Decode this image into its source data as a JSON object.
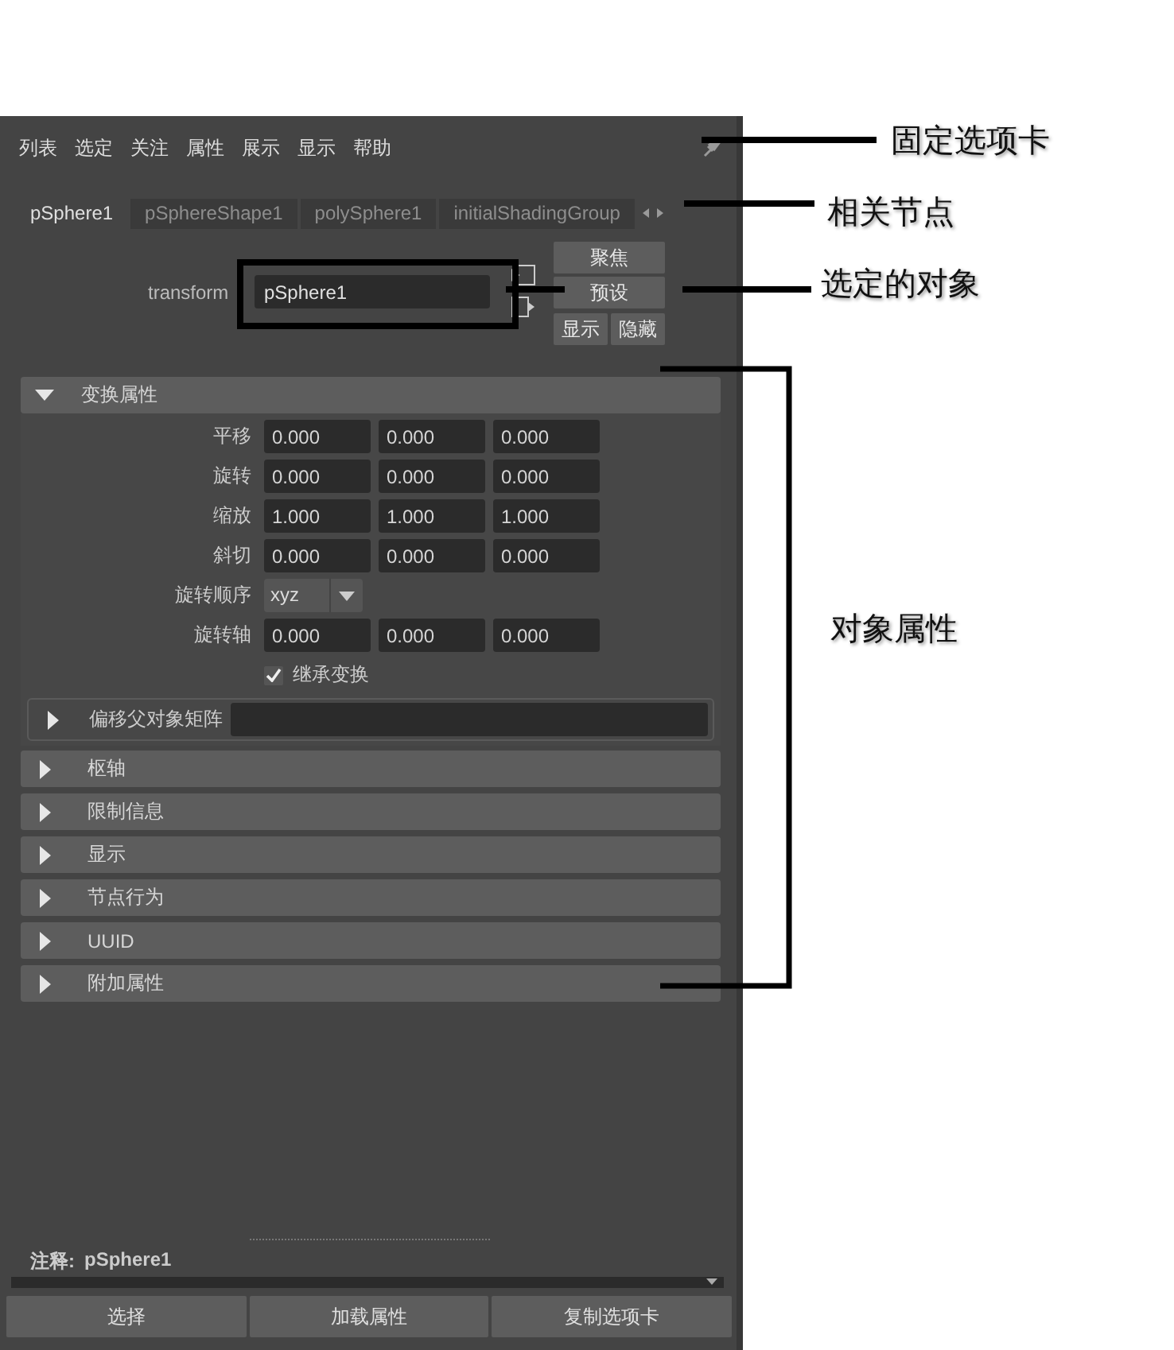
{
  "menu": [
    "列表",
    "选定",
    "关注",
    "属性",
    "展示",
    "显示",
    "帮助"
  ],
  "tabs": [
    {
      "label": "pSphere1",
      "selected": true
    },
    {
      "label": "pSphereShape1",
      "selected": false
    },
    {
      "label": "polySphere1",
      "selected": false
    },
    {
      "label": "initialShadingGroup",
      "selected": false
    }
  ],
  "node": {
    "label": "transform",
    "value": "pSphere1"
  },
  "node_buttons": [
    "聚焦",
    "预设"
  ],
  "show_hide": [
    "显示",
    "隐藏"
  ],
  "sections": [
    {
      "title": "变换属性",
      "expanded": true,
      "rows": [
        {
          "kind": "vector",
          "label": "平移",
          "values": [
            "0.000",
            "0.000",
            "0.000"
          ]
        },
        {
          "kind": "vector",
          "label": "旋转",
          "values": [
            "0.000",
            "0.000",
            "0.000"
          ]
        },
        {
          "kind": "vector",
          "label": "缩放",
          "values": [
            "1.000",
            "1.000",
            "1.000"
          ]
        },
        {
          "kind": "vector",
          "label": "斜切",
          "values": [
            "0.000",
            "0.000",
            "0.000"
          ]
        },
        {
          "kind": "dropdown",
          "label": "旋转顺序",
          "value": "xyz"
        },
        {
          "kind": "vector",
          "label": "旋转轴",
          "values": [
            "0.000",
            "0.000",
            "0.000"
          ]
        },
        {
          "kind": "checkbox",
          "label": "继承变换",
          "checked": true
        }
      ],
      "subsections": [
        {
          "title": "偏移父对象矩阵",
          "expanded": false
        }
      ]
    },
    {
      "title": "枢轴",
      "expanded": false
    },
    {
      "title": "限制信息",
      "expanded": false
    },
    {
      "title": "显示",
      "expanded": false
    },
    {
      "title": "节点行为",
      "expanded": false
    },
    {
      "title": "UUID",
      "expanded": false
    },
    {
      "title": "附加属性",
      "expanded": false
    }
  ],
  "notes": {
    "label": "注释:",
    "value": "pSphere1"
  },
  "bottom_buttons": [
    "选择",
    "加载属性",
    "复制选项卡"
  ],
  "annotations": [
    {
      "text": "固定选项卡"
    },
    {
      "text": "相关节点"
    },
    {
      "text": "选定的对象"
    },
    {
      "text": "对象属性"
    }
  ]
}
